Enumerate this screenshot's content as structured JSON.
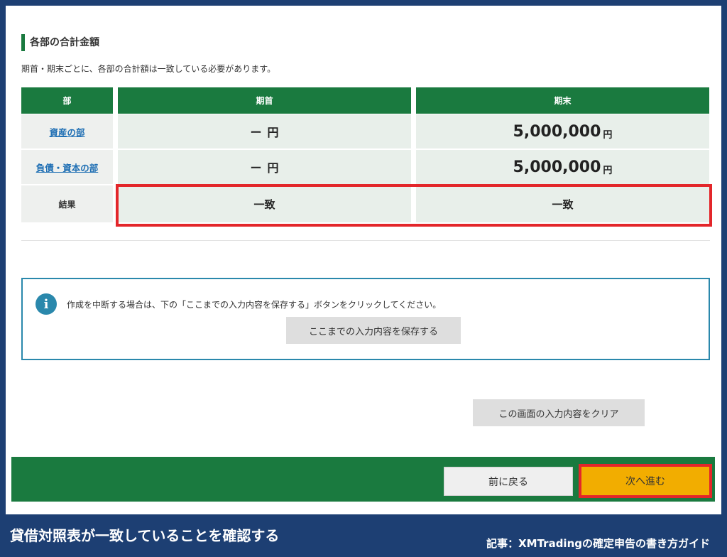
{
  "section": {
    "title": "各部の合計金額",
    "description": "期首・期末ごとに、各部の合計額は一致している必要があります。"
  },
  "table": {
    "headers": [
      "部",
      "期首",
      "期末"
    ],
    "rows": [
      {
        "label": "資産の部",
        "start": "ー",
        "start_unit": "円",
        "end": "5,000,000",
        "end_unit": "円"
      },
      {
        "label": "負債・資本の部",
        "start": "ー",
        "start_unit": "円",
        "end": "5,000,000",
        "end_unit": "円"
      }
    ],
    "result": {
      "label": "結果",
      "start": "一致",
      "end": "一致"
    }
  },
  "info": {
    "icon": "info-icon",
    "text": "作成を中断する場合は、下の「ここまでの入力内容を保存する」ボタンをクリックしてください。",
    "save_label": "ここまでの入力内容を保存する"
  },
  "actions": {
    "clear_label": "この画面の入力内容をクリア",
    "back_label": "前に戻る",
    "next_label": "次へ進む"
  },
  "caption": {
    "main": "貸借対照表が一致していることを確認する",
    "credit": "記事：XMTradingの確定申告の書き方ガイド"
  },
  "colors": {
    "header_green": "#1a7a3f",
    "link_blue": "#1f6fb4",
    "highlight_red": "#e3262a",
    "next_button": "#f2ad00",
    "frame_navy": "#1d3f73"
  }
}
